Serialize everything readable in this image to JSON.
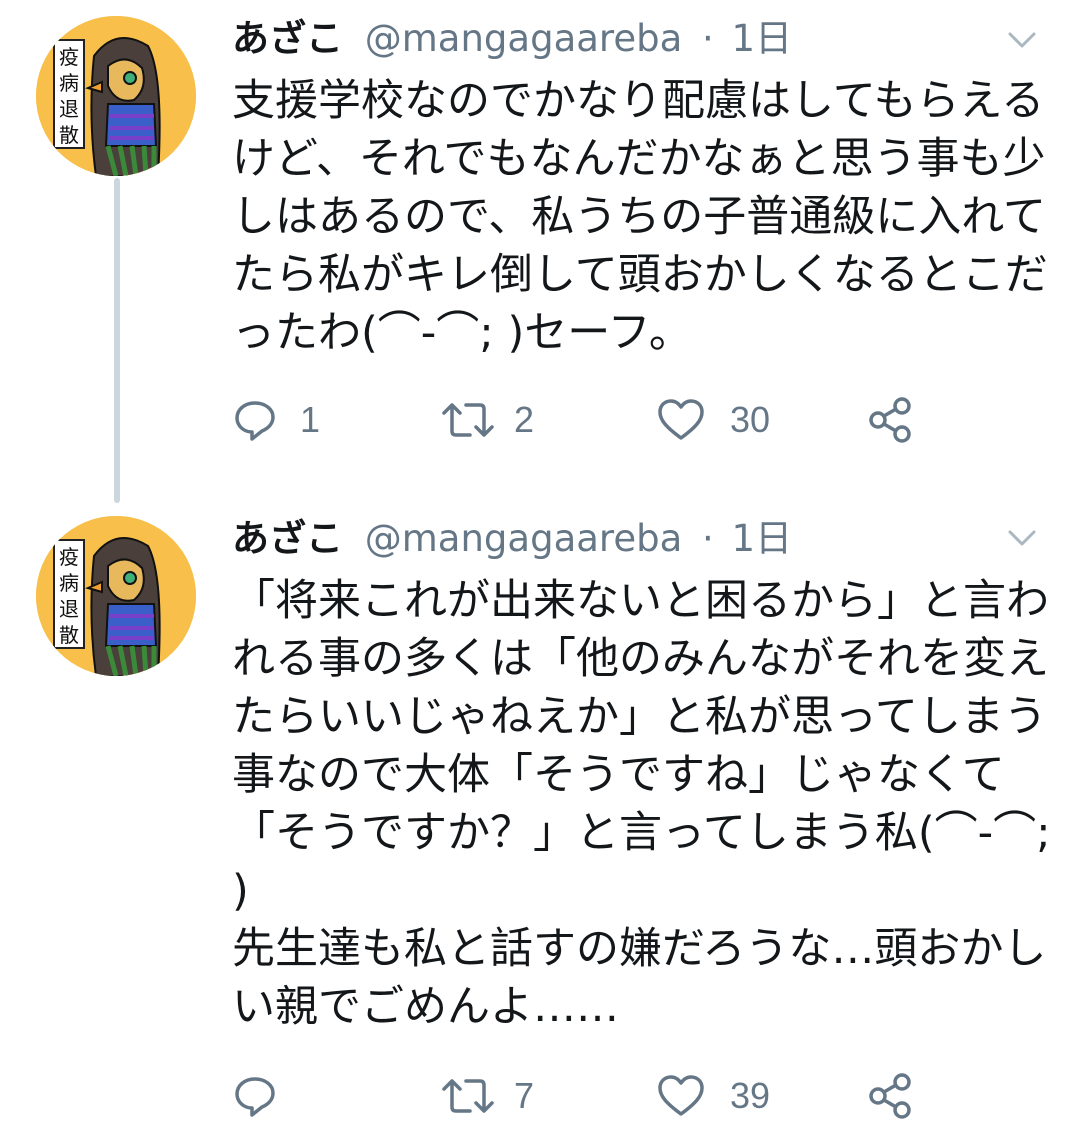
{
  "colors": {
    "accent_text": "#657786",
    "thread_line": "#ccd6dd",
    "avatar_bg": "#f8c04a"
  },
  "avatar": {
    "label_chars": [
      "疫",
      "病",
      "退",
      "散"
    ]
  },
  "tweets": [
    {
      "author_name": "あざこ",
      "author_handle": "@mangagaareba",
      "separator": "·",
      "time": "1日",
      "text": "支援学校なのでかなり配慮はしてもらえるけど、それでもなんだかなぁと思う事も少しはあるので、私うちの子普通級に入れてたら私がキレ倒して頭おかしくなるとこだったわ(⌒-⌒; )セーフ。",
      "replies": "1",
      "retweets": "2",
      "likes": "30",
      "icons": {
        "reply": "reply-icon",
        "retweet": "retweet-icon",
        "like": "heart-icon",
        "share": "share-icon",
        "menu": "chevron-down-icon"
      }
    },
    {
      "author_name": "あざこ",
      "author_handle": "@mangagaareba",
      "separator": "·",
      "time": "1日",
      "text": "「将来これが出来ないと困るから」と言われる事の多くは「他のみんながそれを変えたらいいじゃねえか」と私が思ってしまう事なので大体「そうですね」じゃなくて「そうですか？」と言ってしまう私(⌒-⌒; )\n先生達も私と話すの嫌だろうな…頭おかしい親でごめんよ……",
      "replies": "",
      "retweets": "7",
      "likes": "39",
      "icons": {
        "reply": "reply-icon",
        "retweet": "retweet-icon",
        "like": "heart-icon",
        "share": "share-icon",
        "menu": "chevron-down-icon"
      }
    }
  ]
}
